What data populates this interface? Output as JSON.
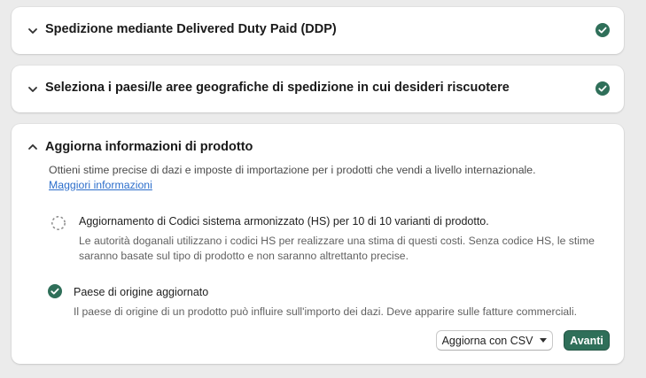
{
  "sections": [
    {
      "title": "Spedizione mediante Delivered Duty Paid (DDP)",
      "completed": true,
      "expanded": false
    },
    {
      "title": "Seleziona i paesi/le aree geografiche di spedizione in cui desideri riscuotere",
      "completed": true,
      "expanded": false
    },
    {
      "title": "Aggiorna informazioni di prodotto",
      "expanded": true,
      "intro_text": "Ottieni stime precise di dazi e imposte di importazione per i prodotti che vendi a livello internazionale.",
      "intro_link": "Maggiori informazioni",
      "steps": [
        {
          "status": "in-progress",
          "title": "Aggiornamento di Codici sistema armonizzato (HS) per 10 di 10 varianti di prodotto.",
          "description": "Le autorità doganali utilizzano i codici HS per realizzare una stima di questi costi. Senza codice HS, le stime saranno basate sul tipo di prodotto e non saranno altrettanto precise."
        },
        {
          "status": "completed",
          "title": "Paese di origine aggiornato",
          "description": "Il paese di origine di un prodotto può influire sull'importo dei dazi. Deve apparire sulle fatture commerciali."
        }
      ],
      "actions": {
        "secondary_label": "Aggiorna con CSV",
        "primary_label": "Avanti"
      }
    }
  ],
  "colors": {
    "success": "#2f6f59",
    "link": "#2c6ecb",
    "background": "#ebebeb"
  },
  "icons": {
    "collapsed": "chevron-down-icon",
    "expanded": "chevron-up-icon",
    "done": "check-circle-icon",
    "pending": "dashed-circle-icon"
  }
}
